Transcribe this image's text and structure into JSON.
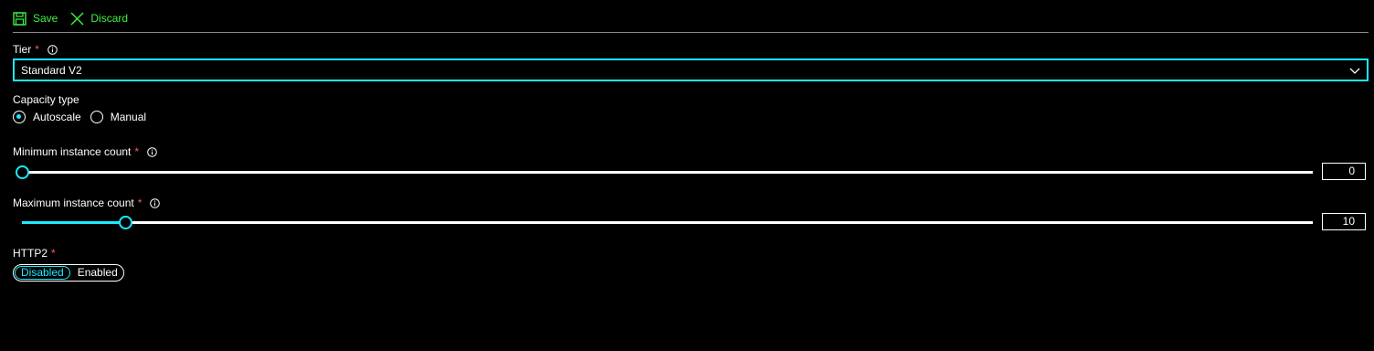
{
  "toolbar": {
    "save_label": "Save",
    "discard_label": "Discard",
    "save_icon": "save-icon",
    "discard_icon": "close-icon"
  },
  "tier": {
    "label": "Tier",
    "required_mark": "*",
    "value": "Standard V2"
  },
  "capacity_type": {
    "label": "Capacity type",
    "options": [
      {
        "label": "Autoscale",
        "checked": true
      },
      {
        "label": "Manual",
        "checked": false
      }
    ]
  },
  "min_instance": {
    "label": "Minimum instance count",
    "required_mark": "*",
    "value": "0",
    "slider_fraction": 0.0
  },
  "max_instance": {
    "label": "Maximum instance count",
    "required_mark": "*",
    "value": "10",
    "slider_fraction": 0.08
  },
  "http2": {
    "label": "HTTP2",
    "required_mark": "*",
    "options": [
      "Disabled",
      "Enabled"
    ],
    "selected": "Disabled"
  },
  "colors": {
    "accent": "#1aebff",
    "toolbar_green": "#3ff23f",
    "required_red": "#ff5a5a",
    "background": "#000000"
  }
}
